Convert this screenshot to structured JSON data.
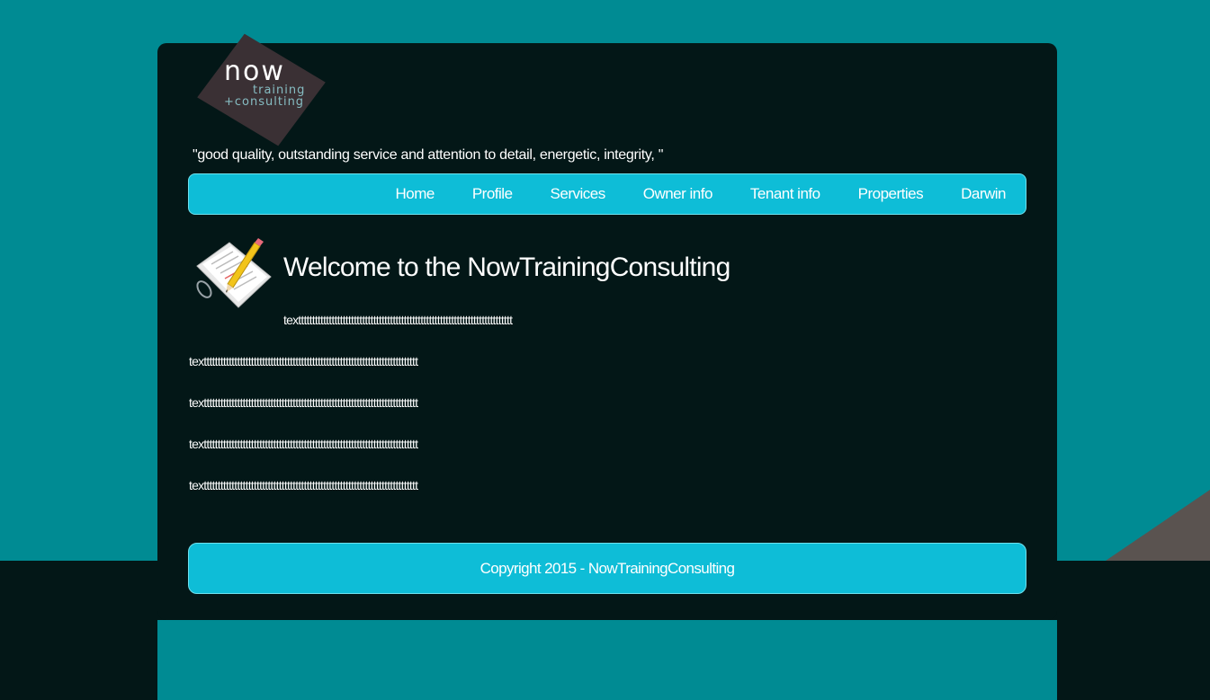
{
  "colors": {
    "page_background": "#008b93",
    "panel_background": "#031717",
    "accent": "#0ebdd7",
    "corner_shape": "#5a5350"
  },
  "logo": {
    "word": "now",
    "line1": "training",
    "line2": "+consulting"
  },
  "tagline": "\"good quality, outstanding service and attention to detail, energetic, integrity, \"",
  "nav": {
    "items": [
      {
        "label": "Home"
      },
      {
        "label": "Profile"
      },
      {
        "label": "Services"
      },
      {
        "label": "Owner info"
      },
      {
        "label": "Tenant info"
      },
      {
        "label": "Properties"
      },
      {
        "label": "Darwin"
      }
    ]
  },
  "content": {
    "icon": "document-pencil-icon",
    "title": "Welcome to the NowTrainingConsulting",
    "intro": "texttttttttttttttttttttttttttttttttttttttttttttttttttttttttttttttttttttttttttttt",
    "paragraphs": [
      "texttttttttttttttttttttttttttttttttttttttttttttttttttttttttttttttttttttttttttttt",
      "texttttttttttttttttttttttttttttttttttttttttttttttttttttttttttttttttttttttttttttt",
      "texttttttttttttttttttttttttttttttttttttttttttttttttttttttttttttttttttttttttttttt",
      "texttttttttttttttttttttttttttttttttttttttttttttttttttttttttttttttttttttttttttttt"
    ]
  },
  "footer": {
    "text": "Copyright 2015 - NowTrainingConsulting"
  }
}
